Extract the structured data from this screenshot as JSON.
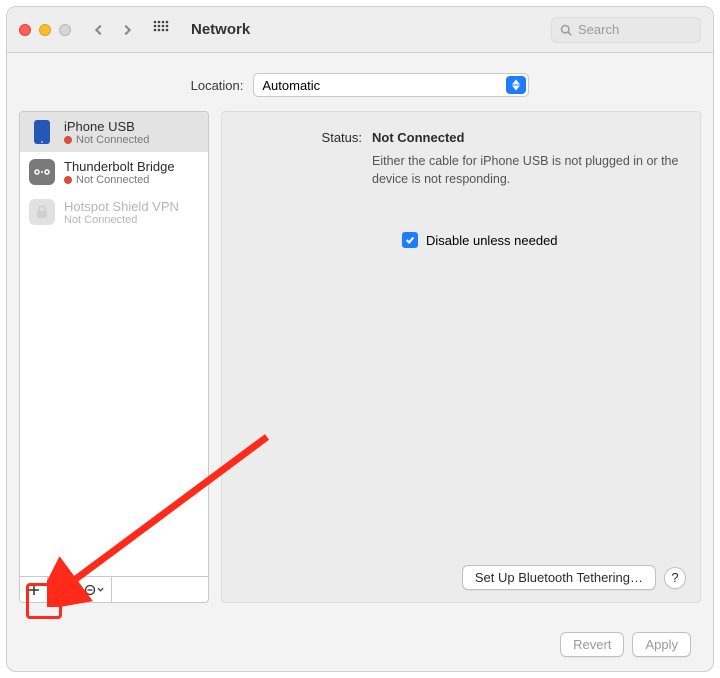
{
  "title": "Network",
  "search_placeholder": "Search",
  "location_label": "Location:",
  "location_value": "Automatic",
  "sidebar": {
    "items": [
      {
        "name": "iPhone USB",
        "status": "Not Connected",
        "has_dot": true,
        "icon": "iphone"
      },
      {
        "name": "Thunderbolt Bridge",
        "status": "Not Connected",
        "has_dot": true,
        "icon": "thunderbolt"
      },
      {
        "name": "Hotspot Shield VPN",
        "status": "Not Connected",
        "has_dot": false,
        "icon": "lock"
      }
    ],
    "add_label": "+",
    "remove_label": "−",
    "options_label": "⊖"
  },
  "detail": {
    "status_label": "Status:",
    "status_value": "Not Connected",
    "status_desc": "Either the cable for iPhone USB is not plugged in or the device is not responding.",
    "disable_label": "Disable unless needed",
    "disable_checked": true,
    "setup_btn": "Set Up Bluetooth Tethering…",
    "help_btn": "?"
  },
  "footer": {
    "revert": "Revert",
    "apply": "Apply"
  }
}
